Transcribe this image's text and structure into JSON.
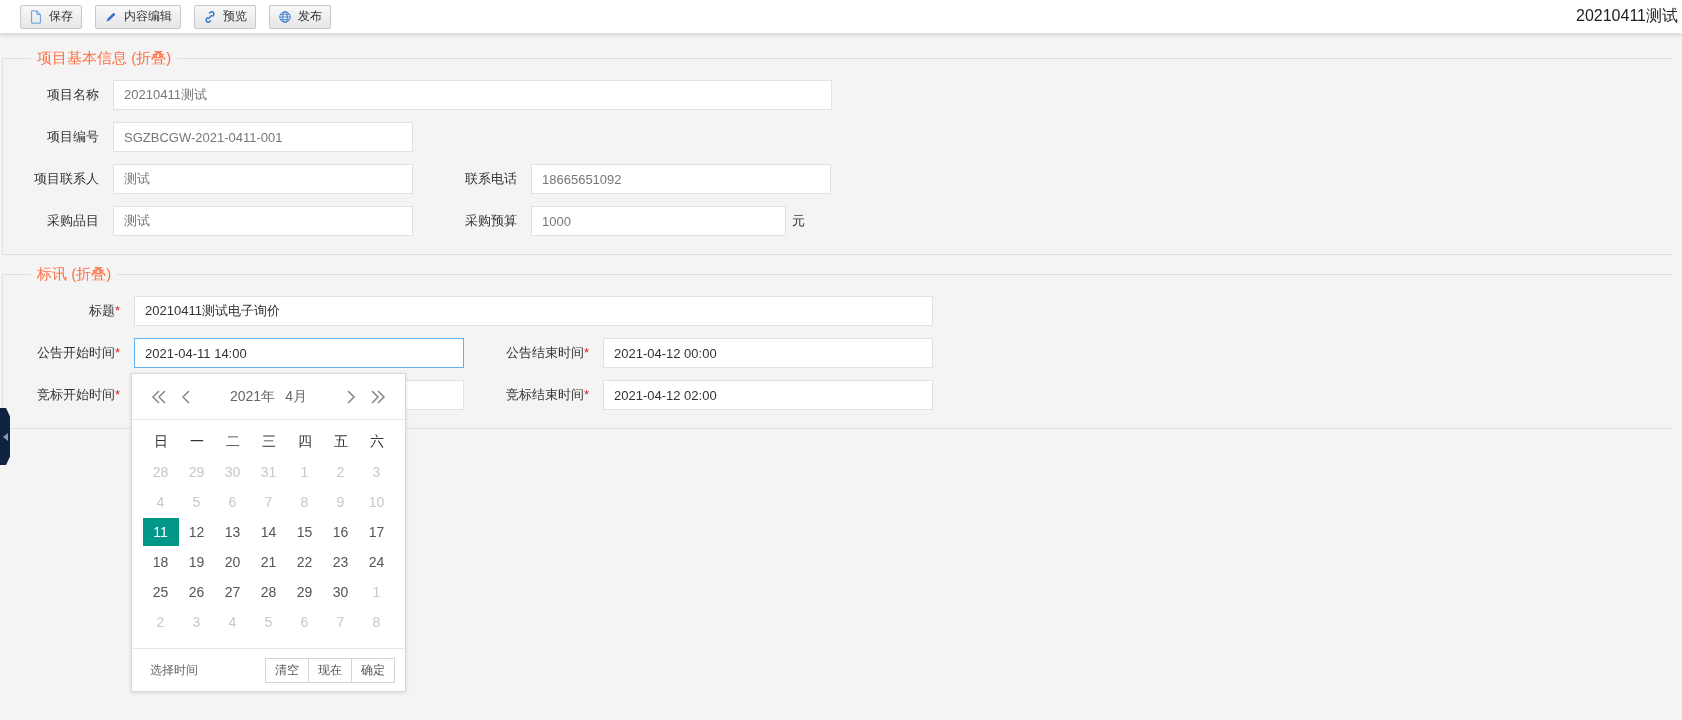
{
  "toolbar": {
    "buttons": [
      {
        "label": "保存"
      },
      {
        "label": "内容编辑"
      },
      {
        "label": "预览"
      },
      {
        "label": "发布"
      }
    ],
    "title": "20210411测试"
  },
  "sections": [
    {
      "title": "项目基本信息",
      "toggle": "(折叠)",
      "rows": [
        [
          {
            "label": "项目名称",
            "value": "20210411测试",
            "kind": "wide",
            "readonly": true
          }
        ],
        [
          {
            "label": "项目编号",
            "value": "SGZBCGW-2021-0411-001",
            "kind": "half",
            "readonly": true
          }
        ],
        [
          {
            "label": "项目联系人",
            "value": "测试",
            "kind": "half",
            "readonly": true
          },
          {
            "label": "联系电话",
            "value": "18665651092",
            "kind": "half",
            "readonly": true
          }
        ],
        [
          {
            "label": "采购品目",
            "value": "测试",
            "kind": "half",
            "readonly": true
          },
          {
            "label": "采购预算",
            "value": "1000",
            "kind": "unit",
            "unit": "元",
            "readonly": true
          }
        ]
      ]
    },
    {
      "title": "标讯",
      "toggle": "(折叠)",
      "rows": [
        [
          {
            "label": "标题",
            "required_mark": "*",
            "value": "20210411测试电子询价",
            "kind": "wide",
            "readonly": false
          }
        ],
        [
          {
            "label": "公告开始时间",
            "required_mark": "*",
            "value": "2021-04-11 14:00",
            "kind": "half",
            "focused": true,
            "readonly": false
          },
          {
            "label": "公告结束时间",
            "required_mark": "*",
            "value": "2021-04-12 00:00",
            "kind": "half",
            "focused": false,
            "readonly": false
          }
        ],
        [
          {
            "label": "竞标开始时间",
            "required_mark": "*",
            "kind": "half",
            "focused": false
          },
          {
            "label": "竞标结束时间",
            "required_mark": "*",
            "value": "2021-04-12 02:00",
            "kind": "half",
            "focused": false,
            "readonly": false
          }
        ]
      ]
    }
  ],
  "date_picker": {
    "year": "2021年",
    "month": "4月",
    "weekdays": [
      "日",
      "一",
      "二",
      "三",
      "四",
      "五",
      "六"
    ],
    "days": [
      {
        "day": "28",
        "in_month": false,
        "selected": false
      },
      {
        "day": "29",
        "in_month": false,
        "selected": false
      },
      {
        "day": "30",
        "in_month": false,
        "selected": false
      },
      {
        "day": "31",
        "in_month": false,
        "selected": false
      },
      {
        "day": "1",
        "in_month": false,
        "selected": false
      },
      {
        "day": "2",
        "in_month": false,
        "selected": false
      },
      {
        "day": "3",
        "in_month": false,
        "selected": false
      },
      {
        "day": "4",
        "in_month": false,
        "selected": false
      },
      {
        "day": "5",
        "in_month": false,
        "selected": false
      },
      {
        "day": "6",
        "in_month": false,
        "selected": false
      },
      {
        "day": "7",
        "in_month": false,
        "selected": false
      },
      {
        "day": "8",
        "in_month": false,
        "selected": false
      },
      {
        "day": "9",
        "in_month": false,
        "selected": false
      },
      {
        "day": "10",
        "in_month": false,
        "selected": false
      },
      {
        "day": "11",
        "in_month": true,
        "selected": true
      },
      {
        "day": "12",
        "in_month": true,
        "selected": false
      },
      {
        "day": "13",
        "in_month": true,
        "selected": false
      },
      {
        "day": "14",
        "in_month": true,
        "selected": false
      },
      {
        "day": "15",
        "in_month": true,
        "selected": false
      },
      {
        "day": "16",
        "in_month": true,
        "selected": false
      },
      {
        "day": "17",
        "in_month": true,
        "selected": false
      },
      {
        "day": "18",
        "in_month": true,
        "selected": false
      },
      {
        "day": "19",
        "in_month": true,
        "selected": false
      },
      {
        "day": "20",
        "in_month": true,
        "selected": false
      },
      {
        "day": "21",
        "in_month": true,
        "selected": false
      },
      {
        "day": "22",
        "in_month": true,
        "selected": false
      },
      {
        "day": "23",
        "in_month": true,
        "selected": false
      },
      {
        "day": "24",
        "in_month": true,
        "selected": false
      },
      {
        "day": "25",
        "in_month": true,
        "selected": false
      },
      {
        "day": "26",
        "in_month": true,
        "selected": false
      },
      {
        "day": "27",
        "in_month": true,
        "selected": false
      },
      {
        "day": "28",
        "in_month": true,
        "selected": false
      },
      {
        "day": "29",
        "in_month": true,
        "selected": false
      },
      {
        "day": "30",
        "in_month": true,
        "selected": false
      },
      {
        "day": "1",
        "in_month": false,
        "selected": false
      },
      {
        "day": "2",
        "in_month": false,
        "selected": false
      },
      {
        "day": "3",
        "in_month": false,
        "selected": false
      },
      {
        "day": "4",
        "in_month": false,
        "selected": false
      },
      {
        "day": "5",
        "in_month": false,
        "selected": false
      },
      {
        "day": "6",
        "in_month": false,
        "selected": false
      },
      {
        "day": "7",
        "in_month": false,
        "selected": false
      },
      {
        "day": "8",
        "in_month": false,
        "selected": false
      }
    ],
    "time_link": "选择时间",
    "buttons": [
      "清空",
      "现在",
      "确定"
    ]
  }
}
